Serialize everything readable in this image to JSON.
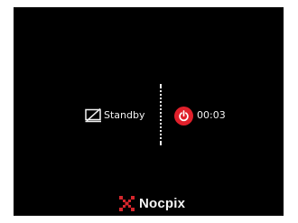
{
  "status": {
    "standby_label": "Standby",
    "standby_icon": "display-off-icon",
    "timer_value": "00:03",
    "power_icon": "power-icon"
  },
  "brand": {
    "name": "Nocpix",
    "logo_icon": "nocpix-logo-icon"
  },
  "colors": {
    "screen_background": "#000000",
    "text": "#f2f2f2",
    "power_accent": "#e0202b",
    "logo_red": "#d6262c"
  }
}
